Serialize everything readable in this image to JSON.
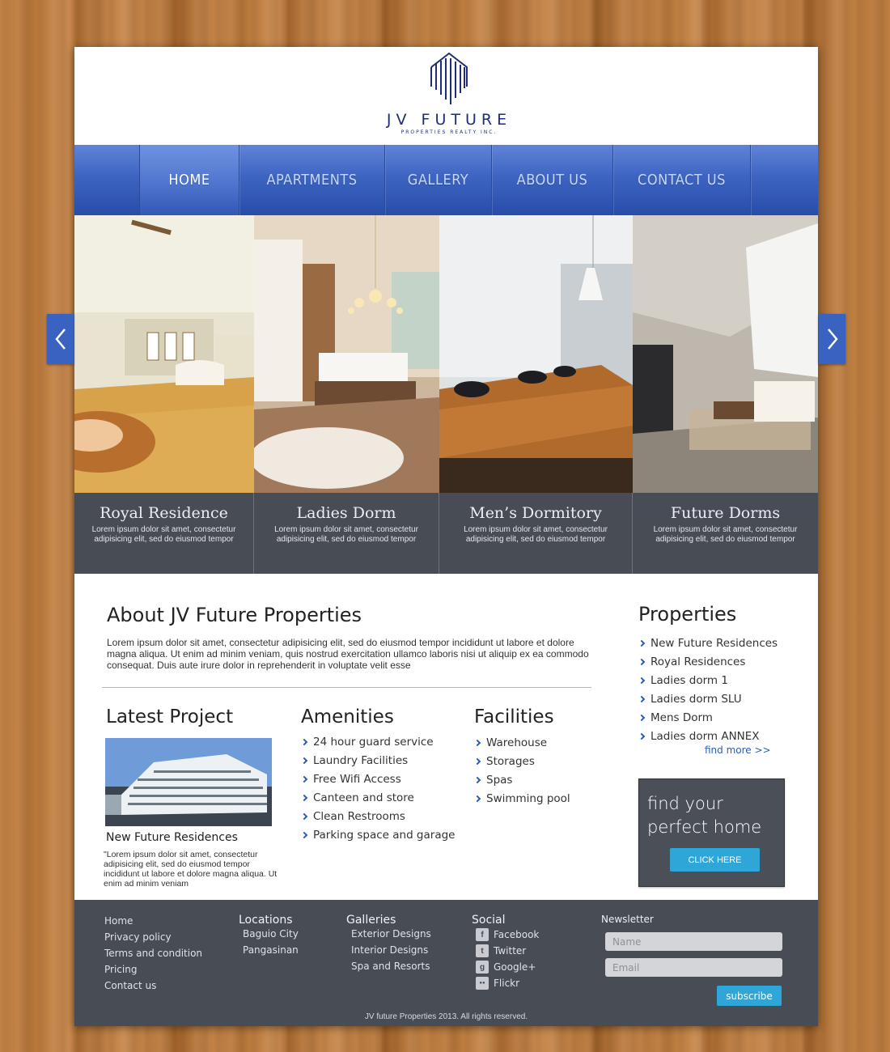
{
  "brand": {
    "name": "JV FUTURE",
    "tagline": "PROPERTIES REALTY INC.",
    "color": "#1f2d78"
  },
  "nav": {
    "items": [
      {
        "label": "HOME",
        "active": true
      },
      {
        "label": "APARTMENTS",
        "active": false
      },
      {
        "label": "GALLERY",
        "active": false
      },
      {
        "label": "ABOUT US",
        "active": false
      },
      {
        "label": "CONTACT US",
        "active": false
      }
    ]
  },
  "slider": {
    "slides": [
      {
        "title": "Royal Residence",
        "text": "Lorem ipsum dolor sit amet, consectetur adipisicing elit, sed do eiusmod tempor"
      },
      {
        "title": "Ladies Dorm",
        "text": "Lorem ipsum dolor sit amet, consectetur adipisicing elit, sed do eiusmod tempor"
      },
      {
        "title": "Men’s Dormitory",
        "text": "Lorem ipsum dolor sit amet, consectetur adipisicing elit, sed do eiusmod tempor"
      },
      {
        "title": "Future Dorms",
        "text": "Lorem ipsum dolor sit amet, consectetur adipisicing elit, sed do eiusmod tempor"
      }
    ],
    "prev_icon": "chevron-left-icon",
    "next_icon": "chevron-right-icon"
  },
  "about": {
    "title": "About JV Future Properties",
    "text": "Lorem ipsum dolor sit amet, consectetur adipisicing elit, sed do eiusmod tempor incididunt ut labore et dolore magna aliqua. Ut enim ad minim veniam, quis nostrud exercitation ullamco laboris nisi ut aliquip ex ea commodo consequat. Duis aute irure dolor in reprehenderit in voluptate velit esse"
  },
  "latest_project": {
    "title": "Latest Project",
    "name": "New Future Residences",
    "text": "\"Lorem ipsum dolor sit amet, consectetur adipisicing elit, sed do eiusmod tempor incididunt ut labore et dolore magna aliqua. Ut enim ad minim veniam"
  },
  "amenities": {
    "title": "Amenities",
    "items": [
      "24 hour guard service",
      "Laundry Facilities",
      "Free Wifi Access",
      "Canteen and store",
      "Clean Restrooms",
      "Parking space and garage"
    ]
  },
  "facilities": {
    "title": "Facilities",
    "items": [
      "Warehouse",
      "Storages",
      "Spas",
      "Swimming pool"
    ]
  },
  "properties": {
    "title": "Properties",
    "items": [
      "New Future Residences",
      "Royal Residences",
      "Ladies dorm 1",
      "Ladies dorm SLU",
      "Mens Dorm",
      "Ladies dorm ANNEX"
    ],
    "find_more": "find more >>"
  },
  "cta": {
    "text": "find your perfect home",
    "button": "CLICK HERE"
  },
  "footer": {
    "links": [
      "Home",
      "Privacy policy",
      "Terms and condition",
      "Pricing",
      "Contact us"
    ],
    "locations": {
      "title": "Locations",
      "items": [
        "Baguio City",
        "Pangasinan"
      ]
    },
    "galleries": {
      "title": "Galleries",
      "items": [
        "Exterior Designs",
        "Interior Designs",
        "Spa and Resorts"
      ]
    },
    "social": {
      "title": "Social",
      "items": [
        {
          "label": "Facebook",
          "icon": "facebook-icon",
          "glyph": "f"
        },
        {
          "label": "Twitter",
          "icon": "twitter-icon",
          "glyph": "t"
        },
        {
          "label": "Google+",
          "icon": "google-plus-icon",
          "glyph": "g"
        },
        {
          "label": "Flickr",
          "icon": "flickr-icon",
          "glyph": "●●"
        }
      ]
    },
    "newsletter": {
      "title": "Newsletter",
      "name_placeholder": "Name",
      "email_placeholder": "Email",
      "button": "subscribe"
    },
    "copyright": "JV future Properties 2013. All rights reserved."
  },
  "colors": {
    "nav_blue": "#3e64c2",
    "accent_blue": "#2ea6d8",
    "dark_panel": "#474c55"
  }
}
